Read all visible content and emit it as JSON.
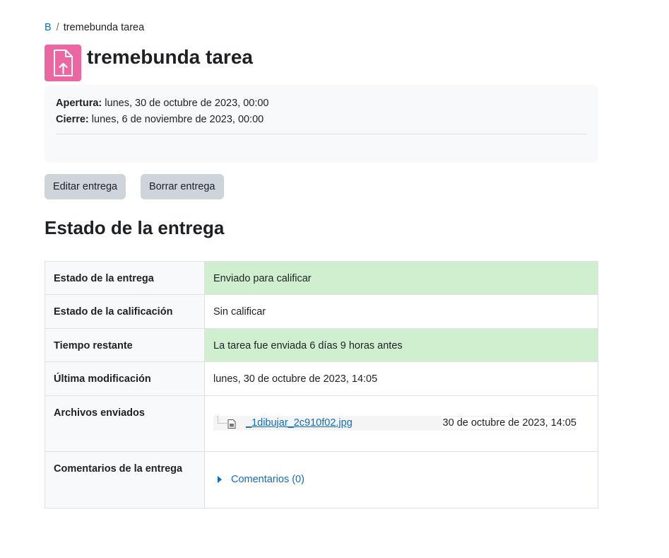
{
  "breadcrumb": {
    "course": "B",
    "separator": "/",
    "current": "tremebunda tarea"
  },
  "page": {
    "title": "tremebunda tarea",
    "icon": "assignment-upload-icon",
    "icon_color": "#eb66a2"
  },
  "dates": {
    "open_label": "Apertura:",
    "open_value": "lunes, 30 de octubre de 2023, 00:00",
    "close_label": "Cierre:",
    "close_value": "lunes, 6 de noviembre de 2023, 00:00"
  },
  "actions": {
    "edit_label": "Editar entrega",
    "delete_label": "Borrar entrega"
  },
  "section": {
    "title": "Estado de la entrega"
  },
  "status": {
    "submission_label": "Estado de la entrega",
    "submission_value": "Enviado para calificar",
    "grading_label": "Estado de la calificación",
    "grading_value": "Sin calificar",
    "time_label": "Tiempo restante",
    "time_value": "La tarea fue enviada 6 días 9 horas antes",
    "modified_label": "Última modificación",
    "modified_value": "lunes, 30 de octubre de 2023, 14:05",
    "files_label": "Archivos enviados",
    "file_name": "_1dibujar_2c910f02.jpg",
    "file_date": "30 de octubre de 2023, 14:05",
    "comments_label": "Comentarios de la entrega",
    "comments_link": "Comentarios (0)"
  },
  "colors": {
    "link": "#0f6cbf",
    "success_bg": "#cfefcf",
    "button_bg": "#ced4da"
  }
}
